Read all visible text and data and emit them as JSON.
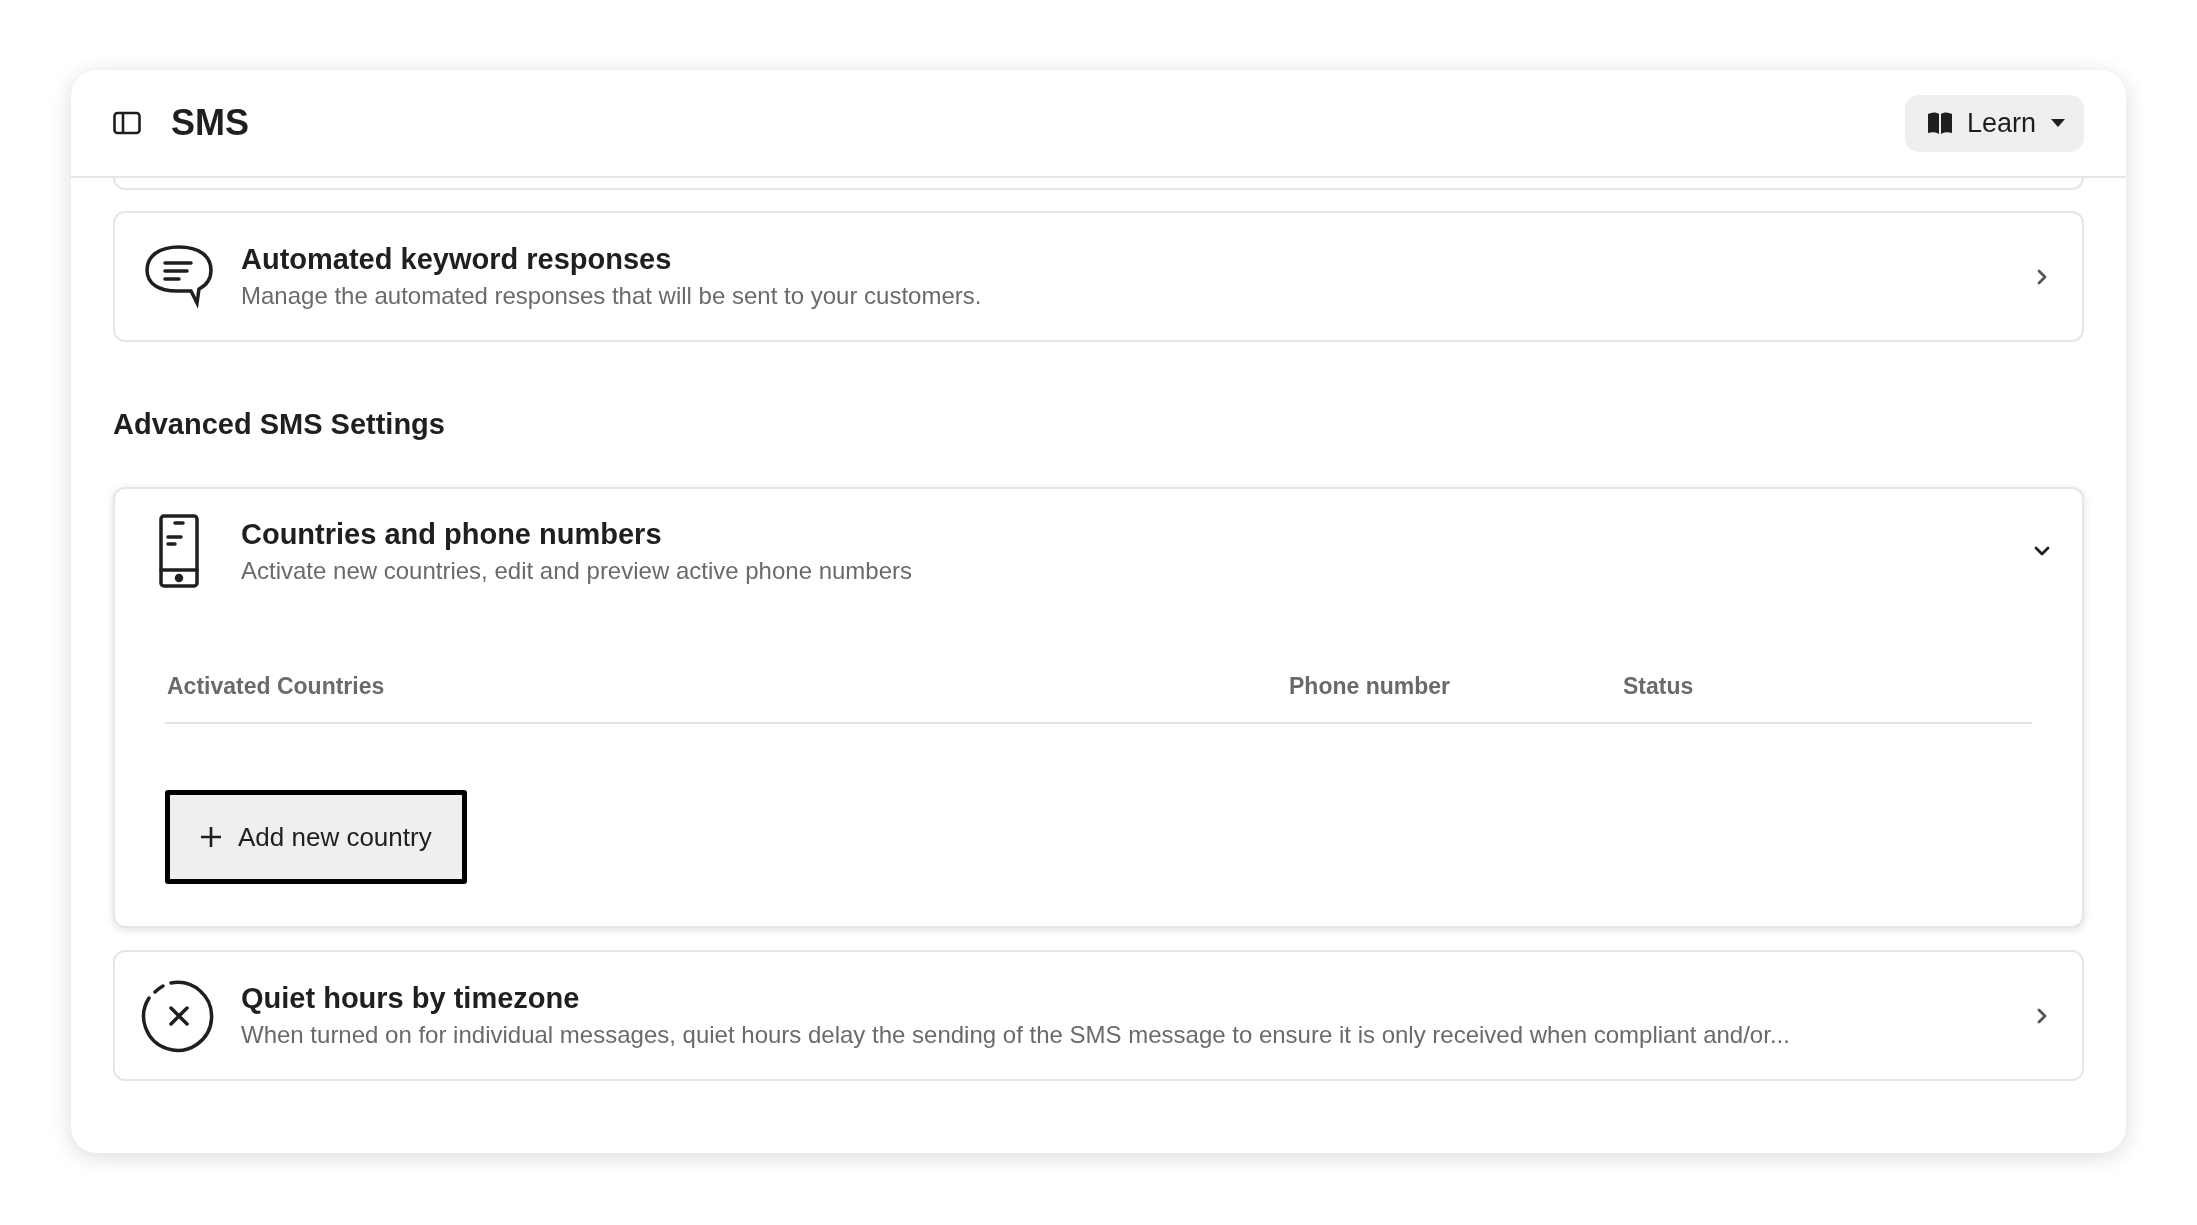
{
  "header": {
    "title": "SMS",
    "learn_button": "Learn"
  },
  "cards": [
    {
      "kind": "chat",
      "title": "Automated keyword responses",
      "description": "Manage the automated responses that will be sent to your customers.",
      "expanded": false
    }
  ],
  "advanced_section": {
    "title": "Advanced SMS Settings",
    "cards": [
      {
        "kind": "phone",
        "title": "Countries and phone numbers",
        "description": "Activate new countries, edit and preview active phone numbers",
        "expanded": true,
        "table": {
          "columns": [
            "Activated Countries",
            "Phone number",
            "Status"
          ]
        },
        "add_button": "Add new country"
      },
      {
        "kind": "timer",
        "title": "Quiet hours by timezone",
        "description": "When turned on for individual messages, quiet hours delay the sending of the SMS message to ensure it is only received when compliant and/or...",
        "expanded": false
      }
    ]
  }
}
